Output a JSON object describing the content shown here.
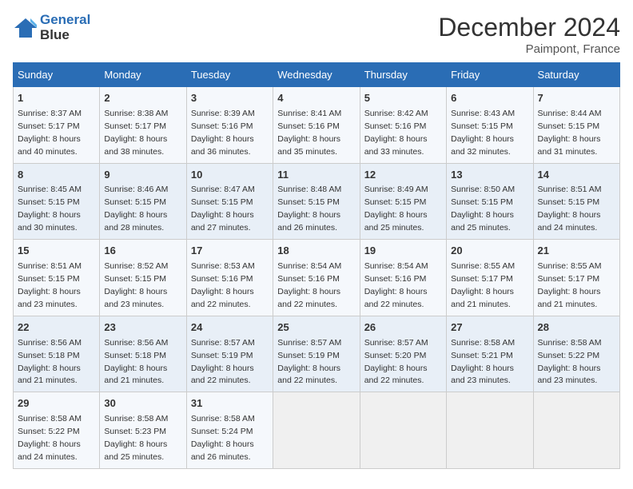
{
  "header": {
    "logo_line1": "General",
    "logo_line2": "Blue",
    "title": "December 2024",
    "location": "Paimpont, France"
  },
  "weekdays": [
    "Sunday",
    "Monday",
    "Tuesday",
    "Wednesday",
    "Thursday",
    "Friday",
    "Saturday"
  ],
  "weeks": [
    [
      {
        "day": "1",
        "sunrise": "8:37 AM",
        "sunset": "5:17 PM",
        "daylight": "8 hours and 40 minutes."
      },
      {
        "day": "2",
        "sunrise": "8:38 AM",
        "sunset": "5:17 PM",
        "daylight": "8 hours and 38 minutes."
      },
      {
        "day": "3",
        "sunrise": "8:39 AM",
        "sunset": "5:16 PM",
        "daylight": "8 hours and 36 minutes."
      },
      {
        "day": "4",
        "sunrise": "8:41 AM",
        "sunset": "5:16 PM",
        "daylight": "8 hours and 35 minutes."
      },
      {
        "day": "5",
        "sunrise": "8:42 AM",
        "sunset": "5:16 PM",
        "daylight": "8 hours and 33 minutes."
      },
      {
        "day": "6",
        "sunrise": "8:43 AM",
        "sunset": "5:15 PM",
        "daylight": "8 hours and 32 minutes."
      },
      {
        "day": "7",
        "sunrise": "8:44 AM",
        "sunset": "5:15 PM",
        "daylight": "8 hours and 31 minutes."
      }
    ],
    [
      {
        "day": "8",
        "sunrise": "8:45 AM",
        "sunset": "5:15 PM",
        "daylight": "8 hours and 30 minutes."
      },
      {
        "day": "9",
        "sunrise": "8:46 AM",
        "sunset": "5:15 PM",
        "daylight": "8 hours and 28 minutes."
      },
      {
        "day": "10",
        "sunrise": "8:47 AM",
        "sunset": "5:15 PM",
        "daylight": "8 hours and 27 minutes."
      },
      {
        "day": "11",
        "sunrise": "8:48 AM",
        "sunset": "5:15 PM",
        "daylight": "8 hours and 26 minutes."
      },
      {
        "day": "12",
        "sunrise": "8:49 AM",
        "sunset": "5:15 PM",
        "daylight": "8 hours and 25 minutes."
      },
      {
        "day": "13",
        "sunrise": "8:50 AM",
        "sunset": "5:15 PM",
        "daylight": "8 hours and 25 minutes."
      },
      {
        "day": "14",
        "sunrise": "8:51 AM",
        "sunset": "5:15 PM",
        "daylight": "8 hours and 24 minutes."
      }
    ],
    [
      {
        "day": "15",
        "sunrise": "8:51 AM",
        "sunset": "5:15 PM",
        "daylight": "8 hours and 23 minutes."
      },
      {
        "day": "16",
        "sunrise": "8:52 AM",
        "sunset": "5:15 PM",
        "daylight": "8 hours and 23 minutes."
      },
      {
        "day": "17",
        "sunrise": "8:53 AM",
        "sunset": "5:16 PM",
        "daylight": "8 hours and 22 minutes."
      },
      {
        "day": "18",
        "sunrise": "8:54 AM",
        "sunset": "5:16 PM",
        "daylight": "8 hours and 22 minutes."
      },
      {
        "day": "19",
        "sunrise": "8:54 AM",
        "sunset": "5:16 PM",
        "daylight": "8 hours and 22 minutes."
      },
      {
        "day": "20",
        "sunrise": "8:55 AM",
        "sunset": "5:17 PM",
        "daylight": "8 hours and 21 minutes."
      },
      {
        "day": "21",
        "sunrise": "8:55 AM",
        "sunset": "5:17 PM",
        "daylight": "8 hours and 21 minutes."
      }
    ],
    [
      {
        "day": "22",
        "sunrise": "8:56 AM",
        "sunset": "5:18 PM",
        "daylight": "8 hours and 21 minutes."
      },
      {
        "day": "23",
        "sunrise": "8:56 AM",
        "sunset": "5:18 PM",
        "daylight": "8 hours and 21 minutes."
      },
      {
        "day": "24",
        "sunrise": "8:57 AM",
        "sunset": "5:19 PM",
        "daylight": "8 hours and 22 minutes."
      },
      {
        "day": "25",
        "sunrise": "8:57 AM",
        "sunset": "5:19 PM",
        "daylight": "8 hours and 22 minutes."
      },
      {
        "day": "26",
        "sunrise": "8:57 AM",
        "sunset": "5:20 PM",
        "daylight": "8 hours and 22 minutes."
      },
      {
        "day": "27",
        "sunrise": "8:58 AM",
        "sunset": "5:21 PM",
        "daylight": "8 hours and 23 minutes."
      },
      {
        "day": "28",
        "sunrise": "8:58 AM",
        "sunset": "5:22 PM",
        "daylight": "8 hours and 23 minutes."
      }
    ],
    [
      {
        "day": "29",
        "sunrise": "8:58 AM",
        "sunset": "5:22 PM",
        "daylight": "8 hours and 24 minutes."
      },
      {
        "day": "30",
        "sunrise": "8:58 AM",
        "sunset": "5:23 PM",
        "daylight": "8 hours and 25 minutes."
      },
      {
        "day": "31",
        "sunrise": "8:58 AM",
        "sunset": "5:24 PM",
        "daylight": "8 hours and 26 minutes."
      },
      null,
      null,
      null,
      null
    ]
  ]
}
